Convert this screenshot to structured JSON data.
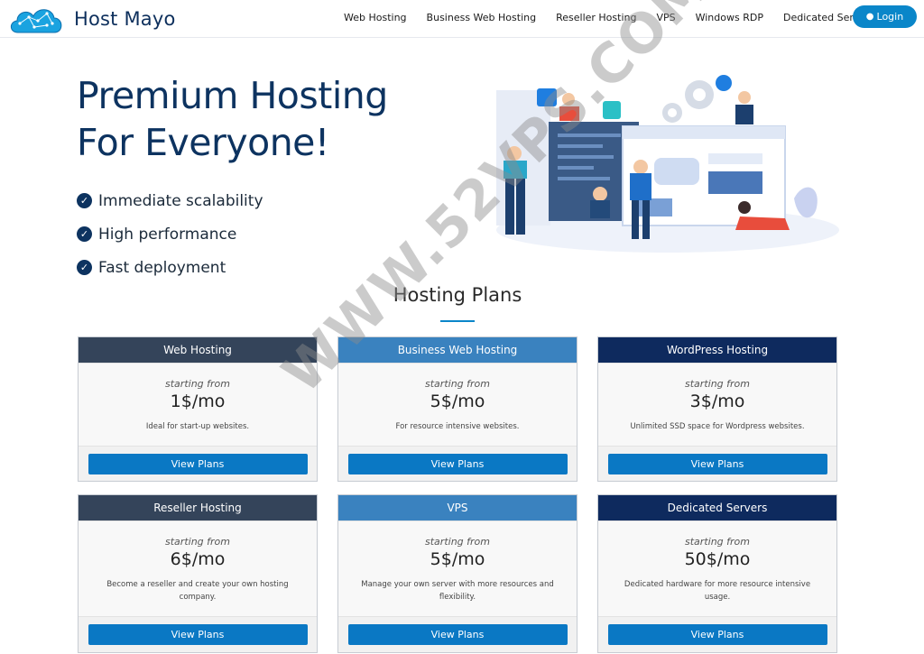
{
  "brand": {
    "name": "Host Mayo"
  },
  "nav": {
    "items": [
      "Web Hosting",
      "Business Web Hosting",
      "Reseller Hosting",
      "VPS",
      "Windows RDP",
      "Dedicated Servers"
    ],
    "login_label": "Login"
  },
  "hero": {
    "title_line1": "Premium Hosting",
    "title_line2": "For Everyone!",
    "features": [
      "Immediate scalability",
      "High performance",
      "Fast deployment"
    ]
  },
  "plans_section": {
    "title": "Hosting Plans"
  },
  "plans": [
    {
      "name": "Web Hosting",
      "starting": "starting from",
      "price": "1$/mo",
      "desc": "Ideal for start-up websites.",
      "button": "View Plans",
      "color": "#34445a"
    },
    {
      "name": "Business Web Hosting",
      "starting": "starting from",
      "price": "5$/mo",
      "desc": "For resource intensive websites.",
      "button": "View Plans",
      "color": "#3a82bf"
    },
    {
      "name": "WordPress Hosting",
      "starting": "starting from",
      "price": "3$/mo",
      "desc": "Unlimited SSD space for Wordpress websites.",
      "button": "View Plans",
      "color": "#0e2a5e"
    },
    {
      "name": "Reseller Hosting",
      "starting": "starting from",
      "price": "6$/mo",
      "desc": "Become a reseller and create your own hosting company.",
      "button": "View Plans",
      "color": "#34445a"
    },
    {
      "name": "VPS",
      "starting": "starting from",
      "price": "5$/mo",
      "desc": "Manage your own server with more resources and flexibility.",
      "button": "View Plans",
      "color": "#3a82bf"
    },
    {
      "name": "Dedicated Servers",
      "starting": "starting from",
      "price": "50$/mo",
      "desc": "Dedicated hardware for more resource intensive usage.",
      "button": "View Plans",
      "color": "#0e2a5e"
    }
  ],
  "watermark": "WWW.52VPS.COM",
  "colors": {
    "primary": "#0d3360",
    "accent": "#0a86c9",
    "button": "#0a78c4"
  }
}
